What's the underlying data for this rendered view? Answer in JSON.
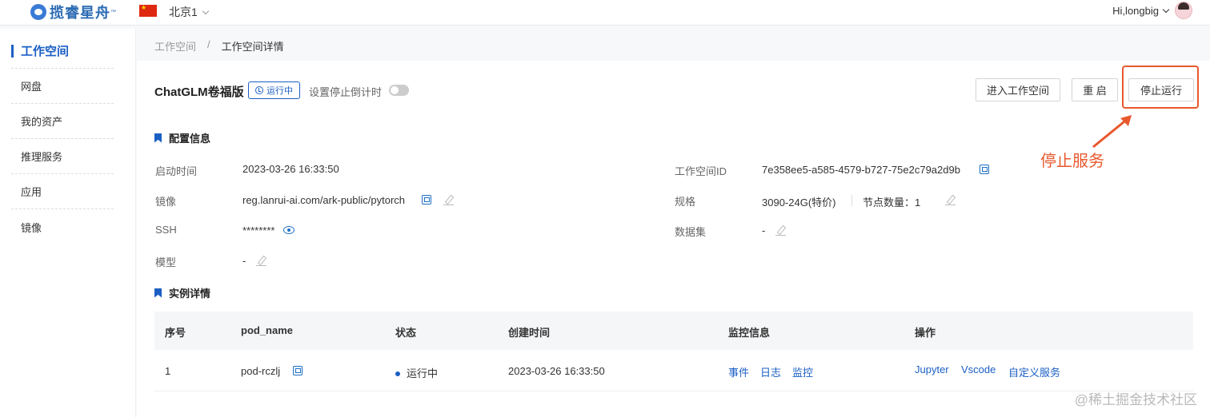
{
  "header": {
    "logo_text": "揽睿星舟",
    "logo_tm": "™",
    "region": "北京1",
    "user": "Hi,longbig"
  },
  "sidebar": {
    "items": [
      {
        "label": "工作空间",
        "active": true
      },
      {
        "label": "网盘"
      },
      {
        "label": "我的资产"
      },
      {
        "label": "推理服务"
      },
      {
        "label": "应用"
      },
      {
        "label": "镜像"
      }
    ]
  },
  "breadcrumb": {
    "root": "工作空间",
    "sep": "/",
    "current": "工作空间详情"
  },
  "workspace": {
    "name": "ChatGLM卷福版",
    "status": "运行中",
    "timer_label": "设置停止倒计时",
    "buttons": {
      "enter": "进入工作空间",
      "restart": "重 启",
      "stop": "停止运行"
    },
    "annotation": "停止服务"
  },
  "config": {
    "title": "配置信息",
    "start_time_label": "启动时间",
    "start_time": "2023-03-26 16:33:50",
    "image_label": "镜像",
    "image": "reg.lanrui-ai.com/ark-public/pytorch",
    "ssh_label": "SSH",
    "ssh": "********",
    "model_label": "模型",
    "model": "-",
    "ws_id_label": "工作空间ID",
    "ws_id": "7e358ee5-a585-4579-b727-75e2c79a2d9b",
    "spec_label": "规格",
    "spec": "3090-24G(特价)",
    "nodes": "节点数量：1",
    "dataset_label": "数据集",
    "dataset": "-"
  },
  "instances": {
    "title": "实例详情",
    "columns": [
      "序号",
      "pod_name",
      "状态",
      "创建时间",
      "监控信息",
      "操作"
    ],
    "rows": [
      {
        "index": "1",
        "pod_name": "pod-rczlj",
        "status": "运行中",
        "created": "2023-03-26 16:33:50",
        "monitor": [
          "事件",
          "日志",
          "监控"
        ],
        "actions": [
          "Jupyter",
          "Vscode",
          "自定义服务"
        ]
      }
    ]
  },
  "watermark": "@稀土掘金技术社区",
  "colors": {
    "accent": "#1b5fc4",
    "annotation": "#e8582c"
  }
}
